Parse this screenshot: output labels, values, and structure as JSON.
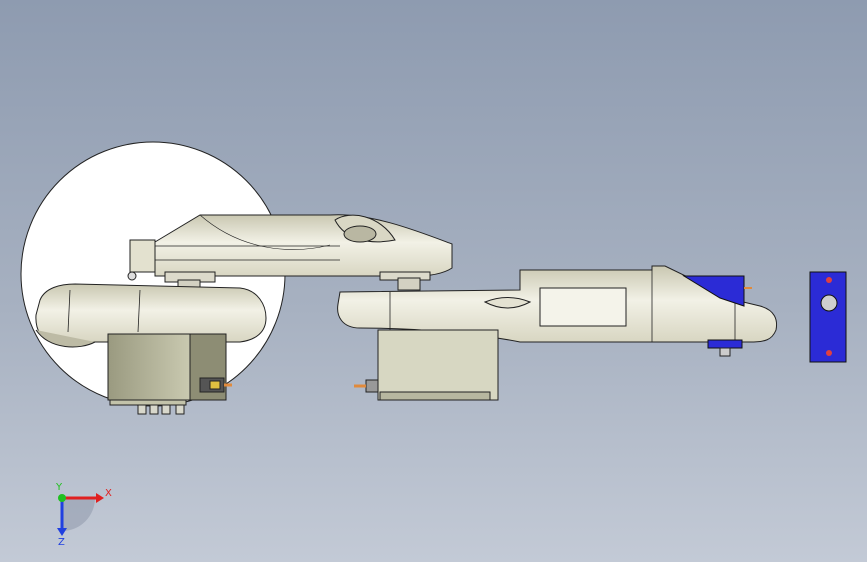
{
  "viewport": {
    "background_top": "#8e9bb0",
    "background_bottom": "#c3cad6"
  },
  "model": {
    "body_color": "#ecebdd",
    "shadow_color": "#bdbba5",
    "servo_color": "#a9a98f",
    "servo_dark": "#8d8d74",
    "accent_blue": "#2b2bd6",
    "pin_color": "#e08a3c",
    "outline_color": "#222222"
  },
  "triad": {
    "x_label": "X",
    "y_label": "Y",
    "z_label": "Z",
    "x_color": "#e02020",
    "y_color": "#20c020",
    "z_color": "#2040e0"
  }
}
